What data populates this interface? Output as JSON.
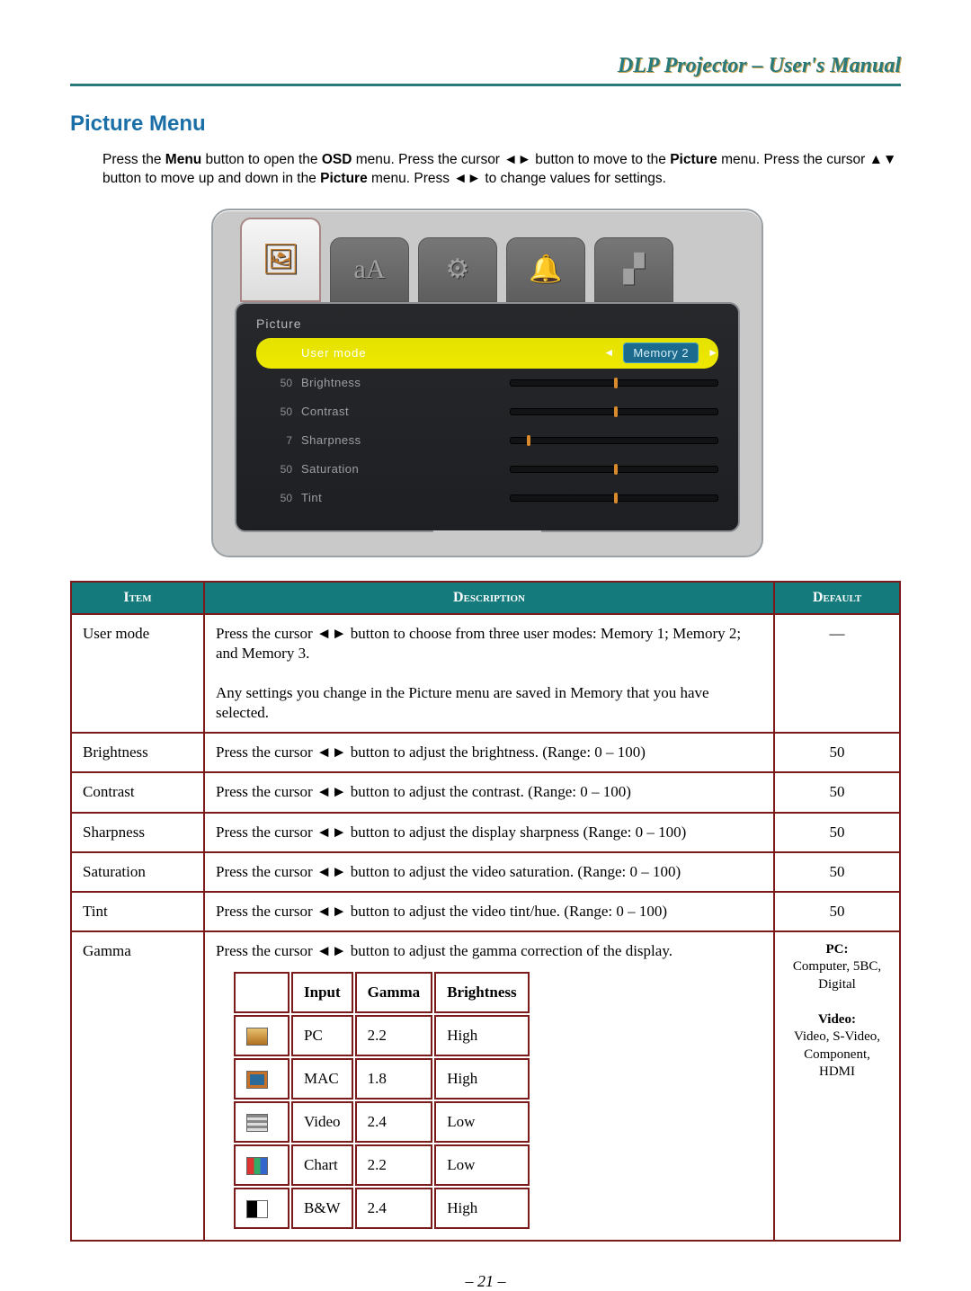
{
  "header": {
    "doc_title": "DLP Projector – User's Manual"
  },
  "section_title": "Picture Menu",
  "intro": {
    "p1a": "Press the ",
    "b1": "Menu",
    "p1b": " button to open the ",
    "b2": "OSD",
    "p1c": " menu. Press the cursor ◄► button to move to the ",
    "b3": "Picture",
    "p1d": " menu. Press the cursor ▲▼ button to move up and down in the ",
    "b4": "Picture",
    "p1e": " menu. Press ◄► to change values for settings."
  },
  "osd": {
    "title": "Picture",
    "rows": {
      "usermode": {
        "label": "User mode",
        "value_label": "Memory 2"
      },
      "brightness": {
        "num": "50",
        "label": "Brightness"
      },
      "contrast": {
        "num": "50",
        "label": "Contrast"
      },
      "sharpness": {
        "num": "7",
        "label": "Sharpness"
      },
      "saturation": {
        "num": "50",
        "label": "Saturation"
      },
      "tint": {
        "num": "50",
        "label": "Tint"
      }
    }
  },
  "table": {
    "headers": {
      "item": "Item",
      "desc": "Description",
      "def": "Default"
    },
    "usermode": {
      "item": "User mode",
      "desc1": "Press the cursor ◄► button to choose from three user modes: Memory 1; Memory 2; and Memory 3.",
      "desc2": "Any settings you change in the Picture menu are saved in Memory that you have selected.",
      "def": "—"
    },
    "brightness": {
      "item": "Brightness",
      "desc": "Press the cursor ◄► button to adjust the brightness. (Range: 0 – 100)",
      "def": "50"
    },
    "contrast": {
      "item": "Contrast",
      "desc": "Press the cursor ◄► button to adjust the contrast. (Range: 0 – 100)",
      "def": "50"
    },
    "sharpness": {
      "item": "Sharpness",
      "desc": "Press the cursor ◄► button to adjust the display sharpness (Range: 0 – 100)",
      "def": "50"
    },
    "saturation": {
      "item": "Saturation",
      "desc": "Press the cursor ◄► button to adjust the video saturation. (Range: 0 – 100)",
      "def": "50"
    },
    "tint": {
      "item": "Tint",
      "desc": "Press the cursor ◄► button to adjust the video tint/hue. (Range: 0 – 100)",
      "def": "50"
    },
    "gamma": {
      "item": "Gamma",
      "desc": "Press the cursor ◄► button to adjust the gamma correction of the display.",
      "sub_headers": {
        "input": "Input",
        "gamma": "Gamma",
        "bright": "Brightness"
      },
      "rows": {
        "pc": {
          "input": "PC",
          "gamma": "2.2",
          "bright": "High"
        },
        "mac": {
          "input": "MAC",
          "gamma": "1.8",
          "bright": "High"
        },
        "video": {
          "input": "Video",
          "gamma": "2.4",
          "bright": "Low"
        },
        "chart": {
          "input": "Chart",
          "gamma": "2.2",
          "bright": "Low"
        },
        "bw": {
          "input": "B&W",
          "gamma": "2.4",
          "bright": "High"
        }
      },
      "def": {
        "pc_h": "PC:",
        "pc_v": "Computer, 5BC, Digital",
        "vid_h": "Video:",
        "vid_v": "Video, S-Video, Component, HDMI"
      }
    }
  },
  "page_number": "– 21 –"
}
